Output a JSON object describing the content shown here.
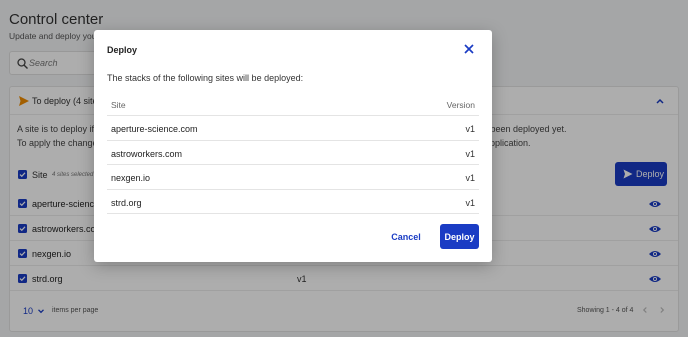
{
  "page": {
    "title": "Control center",
    "subtitle": "Update and deploy your s",
    "search_placeholder": "Search"
  },
  "card": {
    "title": "To deploy (4 site",
    "info_line1_left": "A site is to deploy if a",
    "info_line1_right": "r been deployed yet.",
    "info_line2_left": "To apply the changes",
    "info_line2_right": "application.",
    "deploy_label": "Deploy",
    "header_site": "Site",
    "header_selected": "4 sites selected",
    "rows": [
      {
        "name": "aperture-science",
        "version": ""
      },
      {
        "name": "astroworkers.co",
        "version": ""
      },
      {
        "name": "nexgen.io",
        "version": ""
      },
      {
        "name": "strd.org",
        "version": "v1"
      }
    ],
    "per_page": "10",
    "items_per_page": "items per page",
    "showing": "Showing 1 - 4 of 4"
  },
  "modal": {
    "title": "Deploy",
    "description": "The stacks of the following sites will be deployed:",
    "columns": {
      "site": "Site",
      "version": "Version"
    },
    "rows": [
      {
        "site": "aperture-science.com",
        "version": "v1"
      },
      {
        "site": "astroworkers.com",
        "version": "v1"
      },
      {
        "site": "nexgen.io",
        "version": "v1"
      },
      {
        "site": "strd.org",
        "version": "v1"
      }
    ],
    "cancel_label": "Cancel",
    "deploy_label": "Deploy"
  },
  "colors": {
    "primary": "#1a3cc4",
    "accent_orange": "#f08c00",
    "scrim": "rgba(0,0,0,0.32)"
  }
}
